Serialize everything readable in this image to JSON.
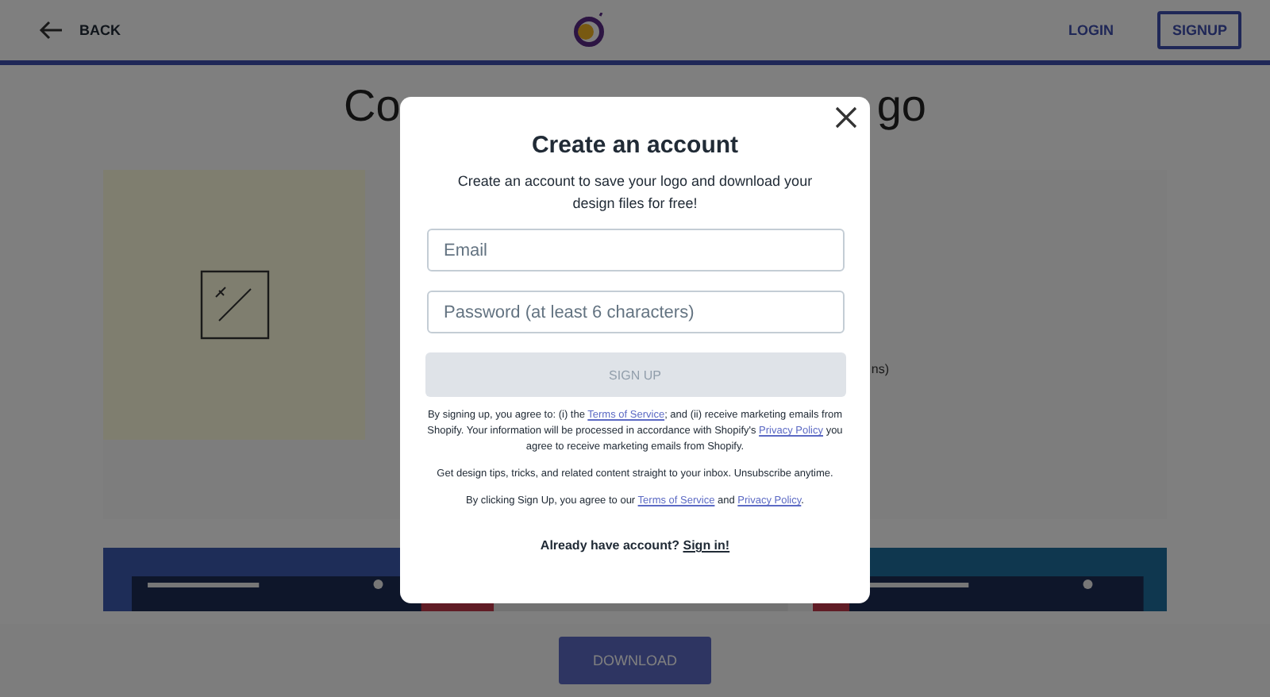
{
  "header": {
    "back": "BACK",
    "login": "LOGIN",
    "signup": "SIGNUP"
  },
  "heading": {
    "left": "Co",
    "right": "go"
  },
  "card": {
    "fragment": "ns)"
  },
  "previews": [
    {
      "kind": "blue"
    },
    {
      "kind": "light"
    },
    {
      "kind": "teal"
    }
  ],
  "download": "DOWNLOAD",
  "modal": {
    "title": "Create an account",
    "subtitle": "Create an account to save your logo and download your design files for free!",
    "fields": [
      {
        "placeholder": "Email"
      },
      {
        "placeholder": "Password (at least 6 characters)"
      }
    ],
    "submit": {
      "label": "SIGN UP",
      "disabled": true
    },
    "legal": [
      [
        {
          "text": "By signing up, you agree to: (i) the "
        },
        {
          "link": "Terms of Service"
        },
        {
          "text": "; and (ii) receive marketing emails from Shopify. Your information will be processed in accordance with Shopify's "
        },
        {
          "link": "Privacy Policy"
        },
        {
          "text": " you agree to receive marketing emails from Shopify."
        }
      ],
      [
        {
          "text": "Get design tips, tricks, and related content straight to your inbox. Unsubscribe anytime."
        }
      ],
      [
        {
          "text": "By clicking Sign Up, you agree to our "
        },
        {
          "link": "Terms of Service"
        },
        {
          "text": " and "
        },
        {
          "link": "Privacy Policy"
        },
        {
          "text": "."
        }
      ]
    ],
    "footer": {
      "text": "Already have account?",
      "link": "Sign in!"
    }
  }
}
